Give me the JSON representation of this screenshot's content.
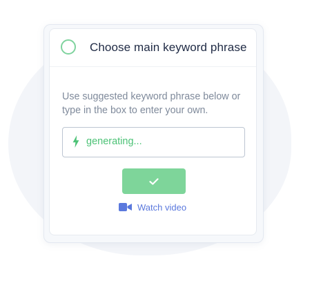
{
  "header": {
    "title": "Choose main keyword phrase"
  },
  "body": {
    "instructions": "Use suggested keyword phrase below or type in the box to enter your own."
  },
  "keyword_input": {
    "value": "generating...",
    "icon": "bolt-icon"
  },
  "confirm_button": {
    "icon": "check-icon"
  },
  "watch_video": {
    "label": "Watch video",
    "icon": "video-camera-icon"
  },
  "colors": {
    "accent_green": "#7ed59a",
    "generating_text": "#4cc276",
    "link_blue": "#5b79dd",
    "title_text": "#1f2a44",
    "body_text": "#7f8a9b"
  }
}
